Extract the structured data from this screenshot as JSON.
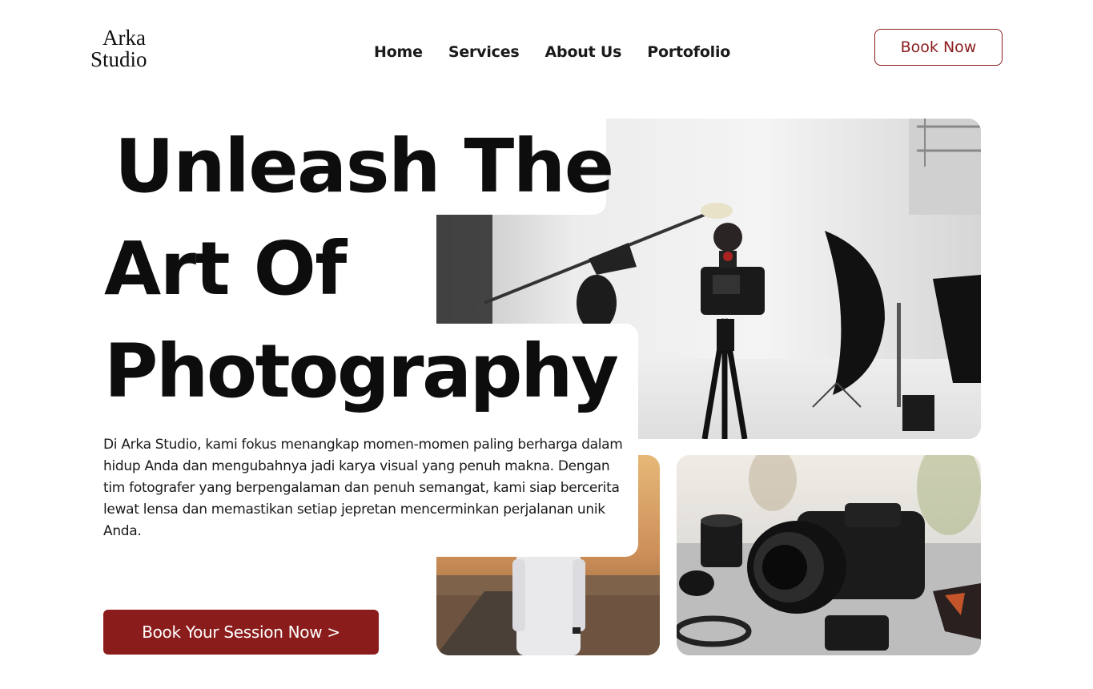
{
  "brand": {
    "logo_line1": "Arka",
    "logo_line2": "Studio"
  },
  "nav": {
    "items": [
      "Home",
      "Services",
      "About Us",
      "Portofolio"
    ]
  },
  "header": {
    "book_label": "Book Now"
  },
  "hero": {
    "title_line1": "Unleash The",
    "title_line2": "Art Of",
    "title_line3": "Photography",
    "description": "Di Arka Studio, kami fokus menangkap momen-momen paling berharga dalam hidup Anda dan mengubahnya jadi karya visual yang penuh makna. Dengan tim fotografer yang berpengalaman dan penuh semangat, kami siap bercerita lewat lensa dan memastikan setiap jepretan mencerminkan perjalanan unik Anda.",
    "cta_label": "Book Your Session Now >"
  },
  "colors": {
    "accent": "#8b1c1c",
    "text": "#111111",
    "background": "#ffffff"
  }
}
